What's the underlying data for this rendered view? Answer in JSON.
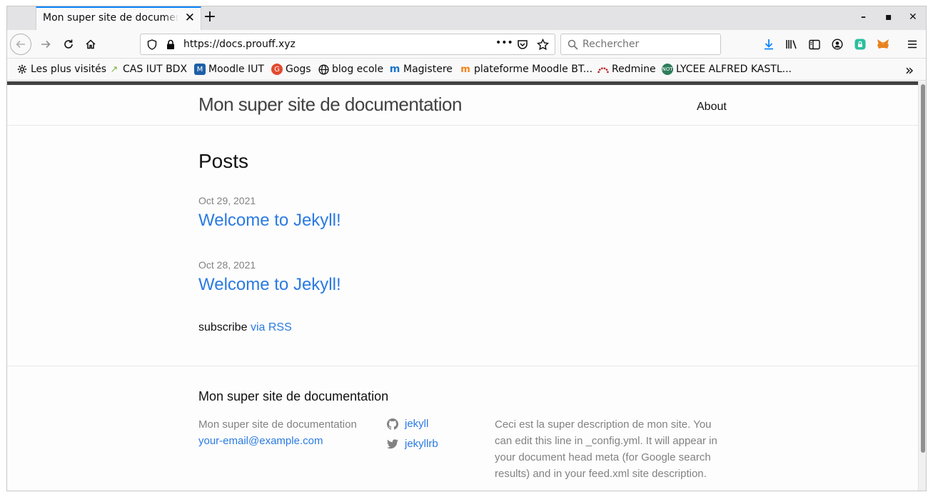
{
  "browser": {
    "tab_title": "Mon super site de documentation",
    "tab_close": "✕",
    "new_tab": "+",
    "url": "https://docs.prouff.xyz",
    "search_placeholder": "Rechercher",
    "page_actions": "•••",
    "window_controls": {
      "minimize": "–",
      "maximize": "▪",
      "close": "✕"
    },
    "bookmarks": [
      {
        "label": "Les plus visités",
        "icon": "gear-icon"
      },
      {
        "label": "CAS IUT BDX",
        "icon": "cas-icon"
      },
      {
        "label": "Moodle IUT",
        "icon": "moodle-icon"
      },
      {
        "label": "Gogs",
        "icon": "gogs-icon"
      },
      {
        "label": "blog ecole",
        "icon": "globe-icon"
      },
      {
        "label": "Magistere",
        "icon": "magistere-icon"
      },
      {
        "label": "plateforme Moodle BT...",
        "icon": "moodle-hat-icon"
      },
      {
        "label": "Redmine",
        "icon": "redmine-icon"
      },
      {
        "label": "LYCEE ALFRED KASTL...",
        "icon": "lycee-icon"
      }
    ],
    "overflow": "»"
  },
  "page": {
    "site_title": "Mon super site de documentation",
    "nav_about": "About",
    "posts_heading": "Posts",
    "posts": [
      {
        "date": "Oct 29, 2021",
        "title": "Welcome to Jekyll!"
      },
      {
        "date": "Oct 28, 2021",
        "title": "Welcome to Jekyll!"
      }
    ],
    "subscribe_text": "subscribe",
    "rss_link": "via RSS",
    "footer": {
      "heading": "Mon super site de documentation",
      "name": "Mon super site de documentation",
      "email": "your-email@example.com",
      "github": "jekyll",
      "twitter": "jekyllrb",
      "description": "Ceci est la super description de mon site. You can edit this line in _config.yml. It will appear in your document head meta (for Google search results) and in your feed.xml site description."
    }
  },
  "colors": {
    "link": "#2a7ae2",
    "text": "#111111",
    "muted": "#828282",
    "download": "#0a84ff"
  }
}
